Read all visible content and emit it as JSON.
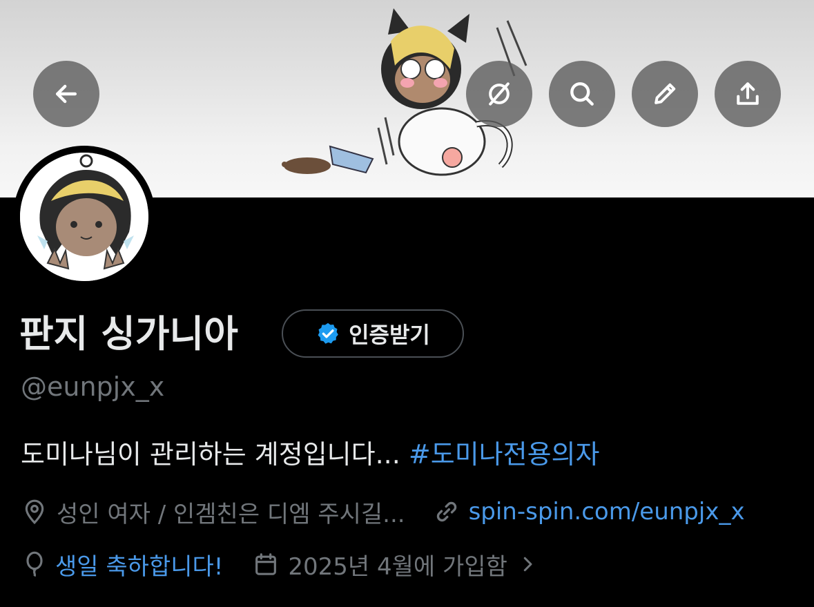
{
  "header": {
    "buttons": [
      {
        "name": "back-button",
        "icon": "back-arrow-icon"
      },
      {
        "name": "grok-button",
        "icon": "slash-circle-icon"
      },
      {
        "name": "search-button",
        "icon": "search-icon"
      },
      {
        "name": "edit-button",
        "icon": "pencil-icon"
      },
      {
        "name": "share-button",
        "icon": "share-icon"
      }
    ]
  },
  "profile": {
    "display_name": "판지 싱가니아",
    "verify_label": "인증받기",
    "handle": "@eunpjx_x",
    "bio_text": "도미나님이 관리하는 계정입니다... ",
    "bio_hashtag": "#도미나전용의자",
    "location": "성인 여자 / 인겜친은 디엠 주시길...",
    "website": "spin-spin.com/eunpjx_x",
    "birthday": "생일 축하합니다!",
    "joined": "2025년 4월에 가입함"
  },
  "colors": {
    "background": "#000000",
    "primary_text": "#e7e9ea",
    "secondary_text": "#71767b",
    "link": "#4a99e9",
    "verified_badge": "#1d9bf0"
  }
}
